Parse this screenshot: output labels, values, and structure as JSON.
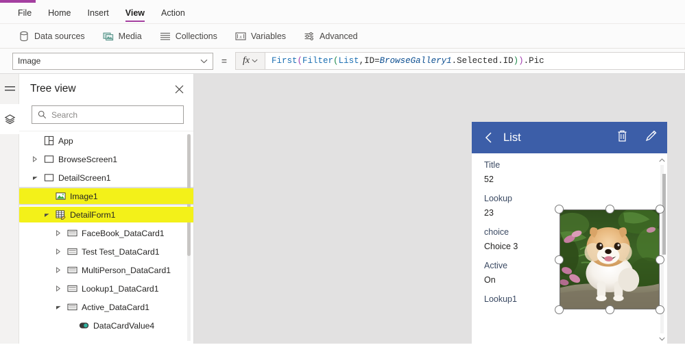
{
  "app": {
    "accent_color": "#a43fa0",
    "canvas_color": "#e2e1e1"
  },
  "menubar": {
    "items": [
      {
        "label": "File",
        "active": false
      },
      {
        "label": "Home",
        "active": false
      },
      {
        "label": "Insert",
        "active": false
      },
      {
        "label": "View",
        "active": true
      },
      {
        "label": "Action",
        "active": false
      }
    ]
  },
  "ribbon": {
    "items": [
      {
        "label": "Data sources",
        "icon": "database-icon"
      },
      {
        "label": "Media",
        "icon": "media-icon"
      },
      {
        "label": "Collections",
        "icon": "list-icon"
      },
      {
        "label": "Variables",
        "icon": "variables-icon"
      },
      {
        "label": "Advanced",
        "icon": "sliders-icon"
      }
    ]
  },
  "formula_bar": {
    "property_value": "Image",
    "equals": "=",
    "fx_label": "fx",
    "formula_tokens": [
      {
        "text": "First",
        "cls": "tk-fn"
      },
      {
        "text": "(",
        "cls": "tk-par"
      },
      {
        "text": "Filter",
        "cls": "tk-fn"
      },
      {
        "text": "(",
        "cls": "tk-par2"
      },
      {
        "text": "List",
        "cls": "tk-id"
      },
      {
        "text": ",ID=",
        "cls": "tk-txt"
      },
      {
        "text": "BrowseGallery1",
        "cls": "tk-var"
      },
      {
        "text": ".Selected.ID",
        "cls": "tk-txt"
      },
      {
        "text": ")",
        "cls": "tk-par2"
      },
      {
        "text": ")",
        "cls": "tk-par"
      },
      {
        "text": ".Pic",
        "cls": "tk-txt"
      }
    ],
    "formula_plain": "First(Filter(List,ID=BrowseGallery1.Selected.ID)).Pic"
  },
  "rail": {
    "items": [
      {
        "icon": "hamburger-icon",
        "selected": false
      },
      {
        "icon": "layers-icon",
        "selected": true
      }
    ]
  },
  "tree_view": {
    "title": "Tree view",
    "close_label": "✕",
    "search_placeholder": "Search",
    "nodes": [
      {
        "label": "App",
        "indent": 0,
        "icon": "app-icon",
        "twisty": "none",
        "selected": false,
        "highlight": false
      },
      {
        "label": "BrowseScreen1",
        "indent": 0,
        "icon": "screen-icon",
        "twisty": "collapsed",
        "selected": false,
        "highlight": false
      },
      {
        "label": "DetailScreen1",
        "indent": 0,
        "icon": "screen-icon",
        "twisty": "expanded",
        "selected": false,
        "highlight": false
      },
      {
        "label": "Image1",
        "indent": 1,
        "icon": "image-icon",
        "twisty": "none",
        "selected": true,
        "highlight": true
      },
      {
        "label": "DetailForm1",
        "indent": 1,
        "icon": "form-icon",
        "twisty": "expanded",
        "selected": false,
        "highlight": true
      },
      {
        "label": "FaceBook_DataCard1",
        "indent": 2,
        "icon": "datacard-icon",
        "twisty": "collapsed",
        "selected": false,
        "highlight": false
      },
      {
        "label": "Test Test_DataCard1",
        "indent": 2,
        "icon": "datacard-icon",
        "twisty": "collapsed",
        "selected": false,
        "highlight": false
      },
      {
        "label": "MultiPerson_DataCard1",
        "indent": 2,
        "icon": "datacard-icon",
        "twisty": "collapsed",
        "selected": false,
        "highlight": false
      },
      {
        "label": "Lookup1_DataCard1",
        "indent": 2,
        "icon": "datacard-icon",
        "twisty": "collapsed",
        "selected": false,
        "highlight": false
      },
      {
        "label": "Active_DataCard1",
        "indent": 2,
        "icon": "datacard-icon",
        "twisty": "expanded",
        "selected": false,
        "highlight": false
      },
      {
        "label": "DataCardValue4",
        "indent": 3,
        "icon": "toggle-icon",
        "twisty": "none",
        "selected": false,
        "highlight": false
      }
    ]
  },
  "preview": {
    "header": {
      "title": "List",
      "back_icon": "chevron-left-icon",
      "actions": [
        {
          "icon": "trash-icon",
          "name": "delete-record-button"
        },
        {
          "icon": "pencil-icon",
          "name": "edit-record-button"
        }
      ],
      "background": "#3c5ea8"
    },
    "fields": [
      {
        "label": "Title",
        "value": "52"
      },
      {
        "label": "Lookup",
        "value": "23"
      },
      {
        "label": "choice",
        "value": "Choice 3"
      },
      {
        "label": "Active",
        "value": "On"
      },
      {
        "label": "Lookup1",
        "value": ""
      }
    ],
    "selected_image": {
      "name": "Image1",
      "alt": "Pomeranian dog standing on stone path with green foliage and pink flowers",
      "handles": 8
    }
  }
}
